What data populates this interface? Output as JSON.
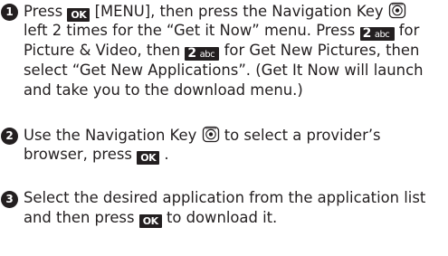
{
  "steps": [
    {
      "number": "1",
      "lines": [
        {
          "a": "Press",
          "key1": "OK",
          "b": " [MENU], then press the Navigation Key"
        },
        {
          "a": "left 2 times for the “Get it Now” menu. Press",
          "key1": "2",
          "key1_letters": "abc",
          "b": "for"
        },
        {
          "a": "Picture & Video, then",
          "key1": "2",
          "key1_letters": "abc",
          "b": "for Get New Pictures, then"
        },
        {
          "a": "select “Get New Applications”. (Get It Now will launch"
        },
        {
          "a": "and take you to the download menu.)"
        }
      ]
    },
    {
      "number": "2",
      "lines": [
        {
          "a": "Use the Navigation Key",
          "b": "to select a provider’s"
        },
        {
          "a": "browser, press",
          "key1": "OK",
          "b": "."
        }
      ]
    },
    {
      "number": "3",
      "lines": [
        {
          "a": "Select the desired application from the application list"
        },
        {
          "a": "and then press",
          "key1": "OK",
          "b": "to download it."
        }
      ]
    }
  ],
  "icons": {
    "ok_key": "ok-key-icon",
    "number_key": "number-key-2-abc-icon",
    "navigation_key": "navigation-key-icon"
  }
}
